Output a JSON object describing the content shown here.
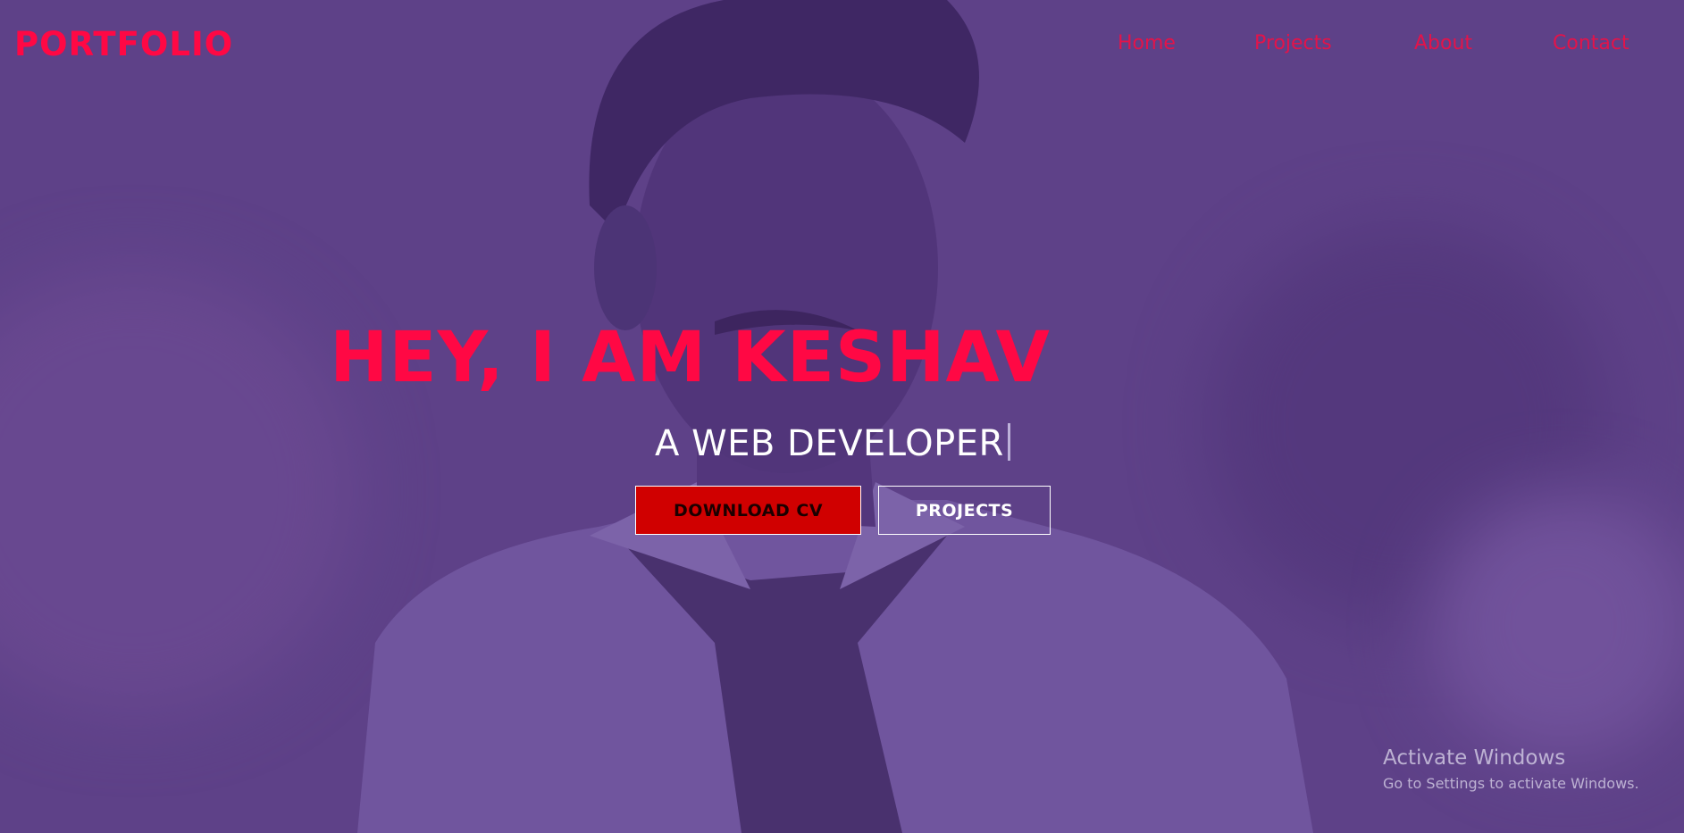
{
  "navbar": {
    "logo": "PORTFOLIO",
    "links": [
      "Home",
      "Projects",
      "About",
      "Contact"
    ]
  },
  "hero": {
    "title": "HEY, I AM KESHAV",
    "subtitle": "A WEB DEVELOPER",
    "buttons": {
      "download_cv": "DOWNLOAD CV",
      "projects": "PROJECTS"
    }
  },
  "watermark": {
    "title": "Activate Windows",
    "subtitle": "Go to Settings to activate Windows."
  },
  "colors": {
    "accent": "#ff0844",
    "button_red": "#d00000",
    "background": "#5e4486"
  }
}
